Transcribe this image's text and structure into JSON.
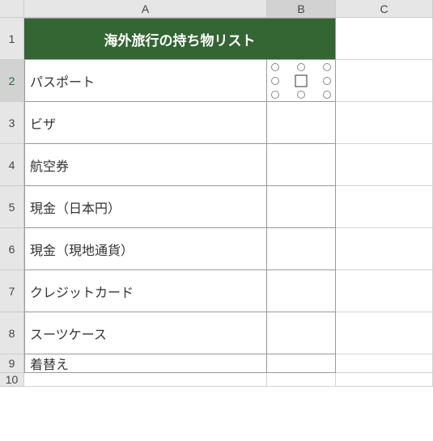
{
  "columns": {
    "A": "A",
    "B": "B",
    "C": "C"
  },
  "rows": {
    "r1": "1",
    "r2": "2",
    "r3": "3",
    "r4": "4",
    "r5": "5",
    "r6": "6",
    "r7": "7",
    "r8": "8",
    "r9": "9",
    "r10": "10"
  },
  "title": "海外旅行の持ち物リスト",
  "items": {
    "i1": "パスポート",
    "i2": "ビザ",
    "i3": "航空券",
    "i4": "現金（日本円）",
    "i5": "現金（現地通貨）",
    "i6": "クレジットカード",
    "i7": "スーツケース",
    "i8": "着替え"
  },
  "selected_object": "checkbox",
  "colors": {
    "header_bg": "#336633",
    "header_fg": "#ffffff"
  }
}
